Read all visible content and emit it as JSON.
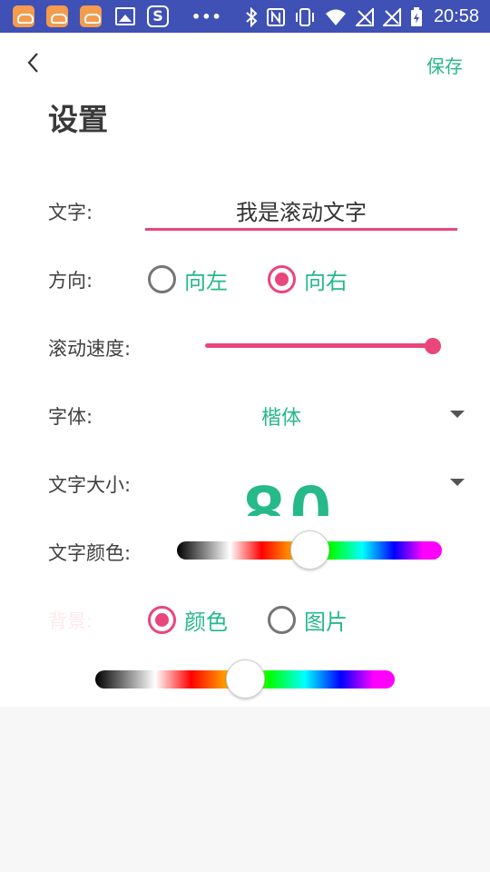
{
  "status_bar": {
    "app_icons": [
      "cloud-app-icon",
      "cloud-app-icon",
      "cloud-app-icon",
      "image-icon",
      "s-app-icon"
    ],
    "overflow": "•••",
    "time": "20:58"
  },
  "header": {
    "save_label": "保存",
    "title": "设置"
  },
  "form": {
    "text_label": "文字:",
    "text_value": "我是滚动文字",
    "direction_label": "方向:",
    "direction_options": [
      {
        "label": "向左",
        "checked": false
      },
      {
        "label": "向右",
        "checked": true
      }
    ],
    "speed_label": "滚动速度:",
    "speed_value": 1.0,
    "font_label": "字体:",
    "font_value": "楷体",
    "size_label": "文字大小:",
    "size_value": "80",
    "text_color_label": "文字颜色:",
    "text_color_position": 0.5,
    "bg_label": "背景:",
    "bg_options": [
      {
        "label": "颜色",
        "checked": true
      },
      {
        "label": "图片",
        "checked": false
      }
    ],
    "bg_color_position": 0.5
  },
  "colors": {
    "accent": "#e9467c",
    "green": "#26b98a",
    "status_bar": "#3f51b5"
  }
}
